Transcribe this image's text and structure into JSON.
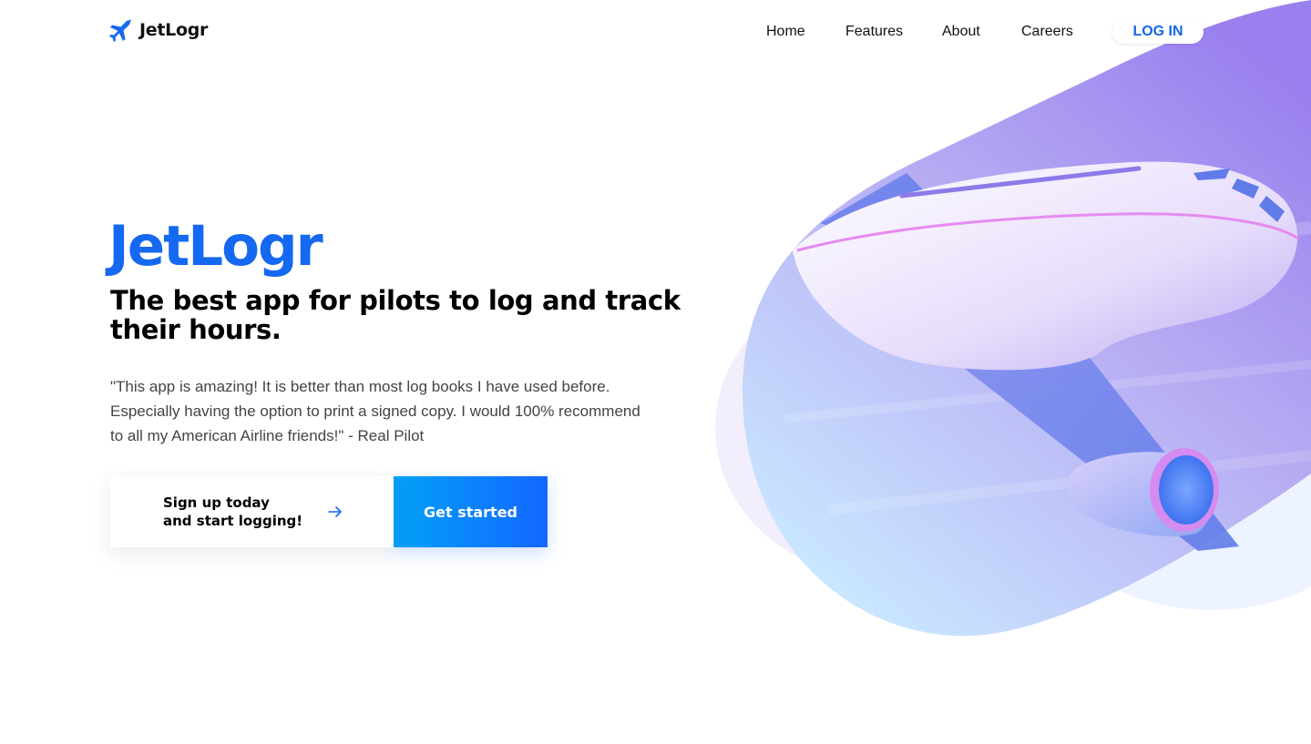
{
  "header": {
    "brand_name": "JetLogr",
    "nav": {
      "home": "Home",
      "features": "Features",
      "about": "About",
      "careers": "Careers"
    },
    "login_label": "LOG IN"
  },
  "hero": {
    "title": "JetLogr",
    "subtitle": "The best app for pilots to log and track their hours.",
    "quote": "\"This app is amazing! It is better than most log books I have used before. Especially having the option to print a signed copy. I would 100% recommend to all my American Airline friends!\" - Real Pilot",
    "signup_line1": "Sign up today",
    "signup_line2": "and start logging!",
    "cta_label": "Get started"
  },
  "icons": {
    "brand": "airplane-icon",
    "signup_arrow": "arrow-right-icon"
  },
  "colors": {
    "brand_blue": "#1568f0",
    "cta_gradient_start": "#02a2f6",
    "cta_gradient_end": "#1466ff",
    "illustration_purple": "#a98ff0"
  }
}
